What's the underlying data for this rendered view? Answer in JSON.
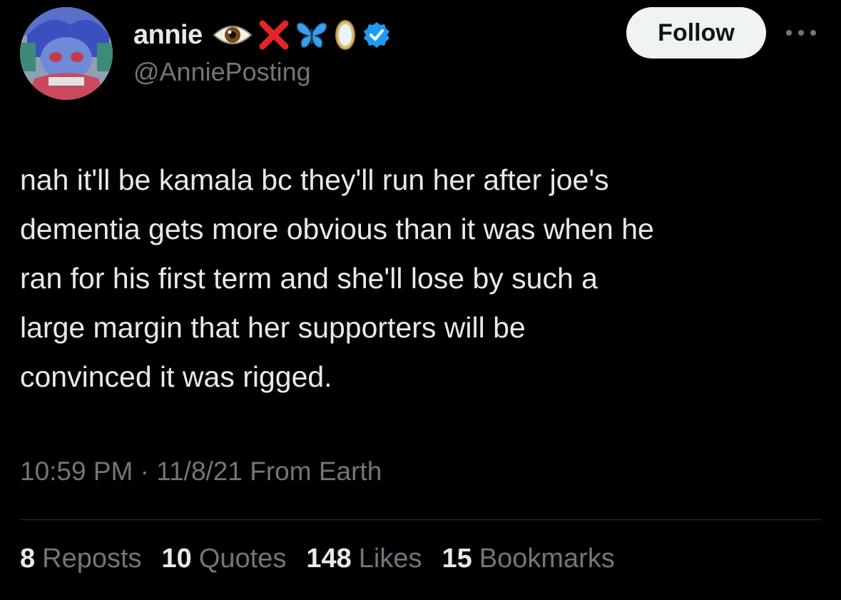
{
  "author": {
    "display_name": "annie",
    "handle": "@AnniePosting",
    "verified": true,
    "name_emojis": [
      "eye-emoji",
      "red-x-emoji",
      "butterfly-emoji",
      "mirror-emoji"
    ],
    "verified_badge_color": "#1d9bf0"
  },
  "follow_button": {
    "label": "Follow"
  },
  "more_menu": {
    "icon": "more-horizontal-icon"
  },
  "tweet": {
    "text": "nah it'll be kamala bc they'll run her after joe's\ndementia gets more obvious than it was when he\nran for his first term and she'll lose by such a\nlarge margin that her supporters will be\nconvinced it was rigged.",
    "time": "10:59 PM",
    "separator": "·",
    "date": "11/8/21",
    "source": "From Earth"
  },
  "stats": {
    "reposts": {
      "count": "8",
      "label": "Reposts"
    },
    "quotes": {
      "count": "10",
      "label": "Quotes"
    },
    "likes": {
      "count": "148",
      "label": "Likes"
    },
    "bookmarks": {
      "count": "15",
      "label": "Bookmarks"
    }
  },
  "colors": {
    "background": "#000000",
    "text_primary": "#e7e9ea",
    "text_secondary": "#71767b",
    "follow_bg": "#eff3f4",
    "divider": "#2f3336"
  }
}
